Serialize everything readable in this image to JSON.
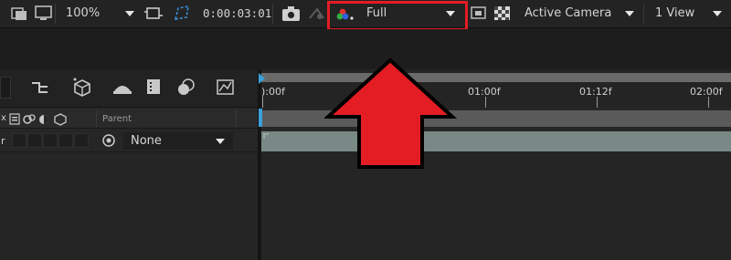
{
  "toolbar": {
    "zoom_level": "100%",
    "timecode": "0:00:03:01",
    "resolution": "Full",
    "camera": "Active Camera",
    "view_layout": "1 View"
  },
  "timeline": {
    "ruler": {
      "start_label": "):00f",
      "labels": [
        "01:00f",
        "01:12f",
        "02:00f"
      ]
    },
    "columns": {
      "parent_header": "Parent",
      "left_stub": "x",
      "layer_stub": "r"
    },
    "layer": {
      "parent_value": "None"
    }
  },
  "colors": {
    "highlight_red": "#e41c24",
    "layer_bar": "#798985",
    "playhead_blue": "#3aa0d8"
  }
}
